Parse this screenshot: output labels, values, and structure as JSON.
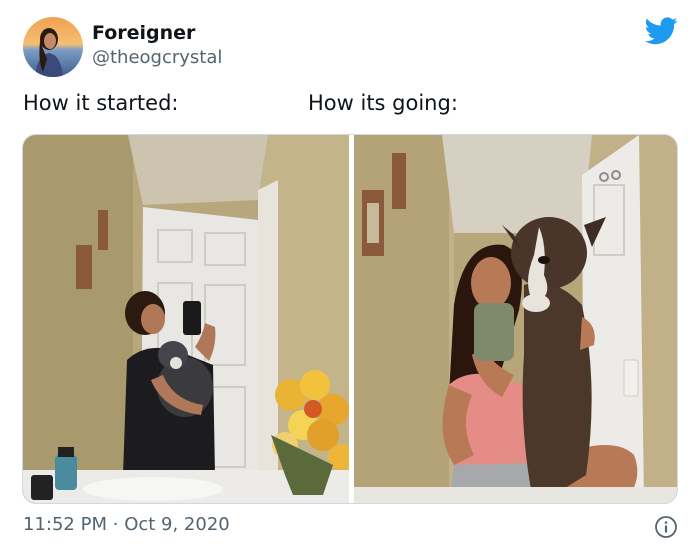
{
  "tweet": {
    "author": {
      "display_name": "Foreigner",
      "handle": "@theogcrystal"
    },
    "caption_left": "How it started:",
    "caption_right": "How its going:",
    "time": "11:52 PM",
    "date_separator": "·",
    "date": "Oct 9, 2020",
    "media": [
      {
        "subject": "mirror selfie of woman holding a puppy in a bathroom"
      },
      {
        "subject": "mirror selfie of woman holding a large grown dog in a bathroom"
      }
    ]
  },
  "colors": {
    "twitter_blue": "#1d9bf0",
    "text_primary": "#0f1419",
    "text_secondary": "#536471"
  },
  "icons": {
    "logo": "twitter-bird-icon",
    "info": "info-icon"
  }
}
